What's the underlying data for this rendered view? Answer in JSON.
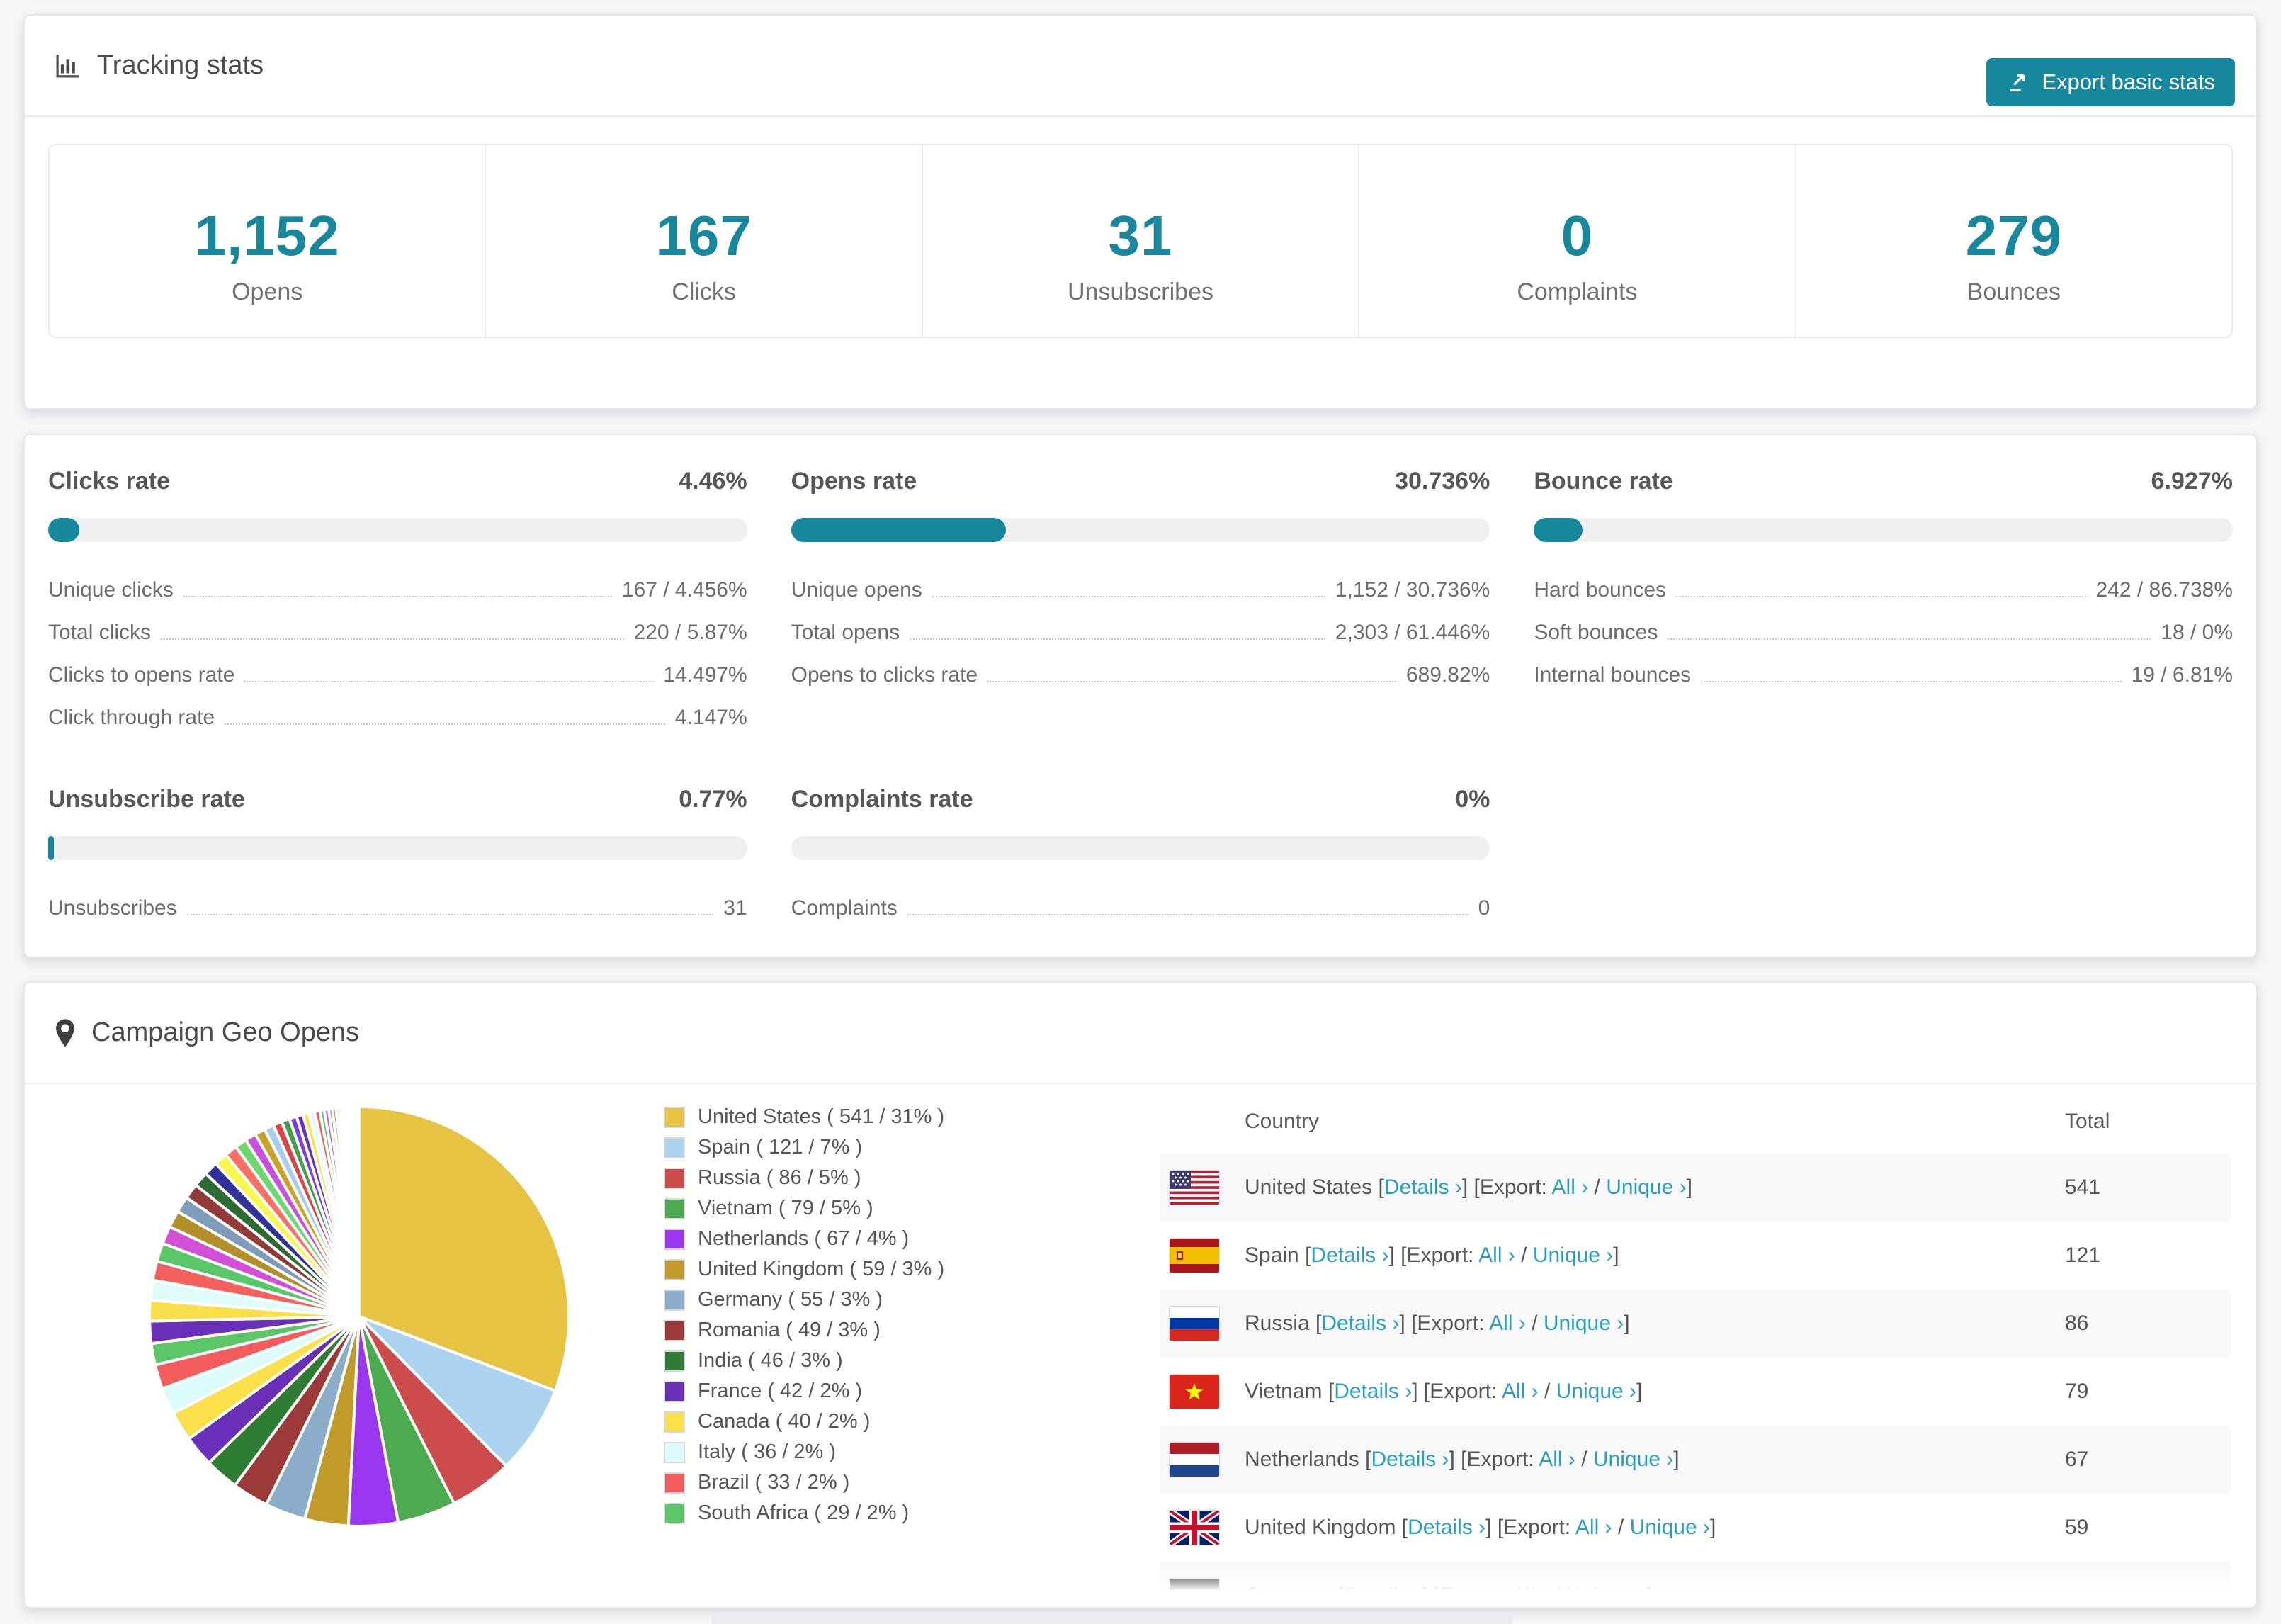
{
  "colors": {
    "accent": "#17879e",
    "link": "#2a9fc1",
    "page_bg": "#f6f6f8"
  },
  "tracking": {
    "title": "Tracking stats",
    "export_button": "Export basic stats",
    "stats": [
      {
        "value": "1,152",
        "label": "Opens"
      },
      {
        "value": "167",
        "label": "Clicks"
      },
      {
        "value": "31",
        "label": "Unsubscribes"
      },
      {
        "value": "0",
        "label": "Complaints"
      },
      {
        "value": "279",
        "label": "Bounces"
      }
    ]
  },
  "rates": [
    {
      "title": "Clicks rate",
      "value": "4.46%",
      "percent": 4.46,
      "rows": [
        {
          "label": "Unique clicks",
          "value": "167 / 4.456%"
        },
        {
          "label": "Total clicks",
          "value": "220 / 5.87%"
        },
        {
          "label": "Clicks to opens rate",
          "value": "14.497%"
        },
        {
          "label": "Click through rate",
          "value": "4.147%"
        }
      ]
    },
    {
      "title": "Opens rate",
      "value": "30.736%",
      "percent": 30.736,
      "rows": [
        {
          "label": "Unique opens",
          "value": "1,152 / 30.736%"
        },
        {
          "label": "Total opens",
          "value": "2,303 / 61.446%"
        },
        {
          "label": "Opens to clicks rate",
          "value": "689.82%"
        }
      ]
    },
    {
      "title": "Bounce rate",
      "value": "6.927%",
      "percent": 6.927,
      "rows": [
        {
          "label": "Hard bounces",
          "value": "242 / 86.738%"
        },
        {
          "label": "Soft bounces",
          "value": "18 / 0%"
        },
        {
          "label": "Internal bounces",
          "value": "19 / 6.81%"
        }
      ]
    },
    {
      "title": "Unsubscribe rate",
      "value": "0.77%",
      "percent": 0.77,
      "rows": [
        {
          "label": "Unsubscribes",
          "value": "31"
        }
      ]
    },
    {
      "title": "Complaints rate",
      "value": "0%",
      "percent": 0,
      "rows": [
        {
          "label": "Complaints",
          "value": "0"
        }
      ]
    }
  ],
  "geo": {
    "title": "Campaign Geo Opens",
    "table": {
      "country_header": "Country",
      "total_header": "Total",
      "details_link": "Details ›",
      "export_prefix": "Export:",
      "all_link": "All ›",
      "unique_link": "Unique ›",
      "rows": [
        {
          "flag": "us",
          "country": "United States",
          "total": "541"
        },
        {
          "flag": "es",
          "country": "Spain",
          "total": "121"
        },
        {
          "flag": "ru",
          "country": "Russia",
          "total": "86"
        },
        {
          "flag": "vn",
          "country": "Vietnam",
          "total": "79"
        },
        {
          "flag": "nl",
          "country": "Netherlands",
          "total": "67"
        },
        {
          "flag": "gb",
          "country": "United Kingdom",
          "total": "59"
        },
        {
          "flag": "de",
          "country": "Germany",
          "total": ""
        }
      ]
    }
  },
  "chart_data": {
    "type": "pie",
    "title": "Campaign Geo Opens",
    "unit": "opens",
    "legend_position": "right-of-chart",
    "series": [
      {
        "label": "United States",
        "value": 541,
        "pct": "31%",
        "color": "#e7c344"
      },
      {
        "label": "Spain",
        "value": 121,
        "pct": "7%",
        "color": "#abd3f0"
      },
      {
        "label": "Russia",
        "value": 86,
        "pct": "5%",
        "color": "#cc4b4b"
      },
      {
        "label": "Vietnam",
        "value": 79,
        "pct": "5%",
        "color": "#4caa50"
      },
      {
        "label": "Netherlands",
        "value": 67,
        "pct": "4%",
        "color": "#9a35f0"
      },
      {
        "label": "United Kingdom",
        "value": 59,
        "pct": "3%",
        "color": "#c09b2a"
      },
      {
        "label": "Germany",
        "value": 55,
        "pct": "3%",
        "color": "#8cadc9"
      },
      {
        "label": "Romania",
        "value": 49,
        "pct": "3%",
        "color": "#9c3a3a"
      },
      {
        "label": "India",
        "value": 46,
        "pct": "3%",
        "color": "#2f7d35"
      },
      {
        "label": "France",
        "value": 42,
        "pct": "2%",
        "color": "#6a2fb8"
      },
      {
        "label": "Canada",
        "value": 40,
        "pct": "2%",
        "color": "#fbe04c"
      },
      {
        "label": "Italy",
        "value": 36,
        "pct": "2%",
        "color": "#dcfbfa"
      },
      {
        "label": "Brazil",
        "value": 33,
        "pct": "2%",
        "color": "#f25c5c"
      },
      {
        "label": "South Africa",
        "value": 29,
        "pct": "2%",
        "color": "#5ac668"
      }
    ],
    "others_unlabeled": {
      "values": [
        30,
        28,
        27,
        26,
        25,
        24,
        23,
        22,
        21,
        20,
        19,
        18,
        17,
        16,
        15,
        14,
        13,
        12,
        11,
        10,
        9,
        8,
        8,
        7,
        6,
        6,
        5,
        5,
        4,
        4,
        3,
        3,
        2,
        2,
        2,
        1,
        1,
        1,
        1,
        1,
        1,
        1,
        1,
        1,
        1,
        1
      ],
      "palette": [
        "#6a2fb8",
        "#f7e04b",
        "#dffbfa",
        "#f2615e",
        "#5ac66a",
        "#d44fd8",
        "#b3902c",
        "#7e9cb8",
        "#933a3a",
        "#2e6b34",
        "#31339b",
        "#f7f74d",
        "#ff6e63",
        "#6fd96f",
        "#c94fe0",
        "#c9a227",
        "#a9cded",
        "#dd4444",
        "#44a04e",
        "#7b3fe4"
      ]
    }
  }
}
